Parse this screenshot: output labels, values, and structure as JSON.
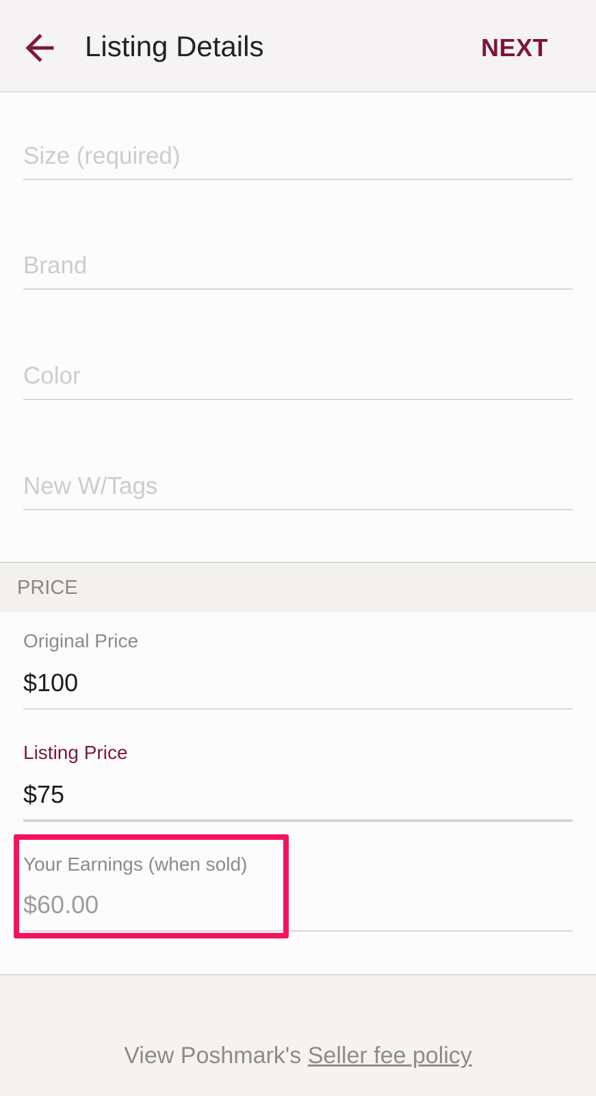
{
  "appbar": {
    "title": "Listing Details",
    "next_label": "NEXT",
    "back_icon": "arrow-left-icon"
  },
  "fields": {
    "size_placeholder": "Size (required)",
    "brand_placeholder": "Brand",
    "color_placeholder": "Color",
    "condition_placeholder": "New W/Tags"
  },
  "price_section": {
    "header": "PRICE",
    "original_label": "Original Price",
    "original_value": "$100",
    "listing_label": "Listing Price",
    "listing_value": "$75",
    "earnings_label": "Your Earnings (when sold)",
    "earnings_value": "$60.00"
  },
  "footer": {
    "prefix": "View Poshmark's ",
    "link": "Seller fee policy"
  },
  "colors": {
    "accent": "#7e1634",
    "highlight": "#f5135e"
  }
}
